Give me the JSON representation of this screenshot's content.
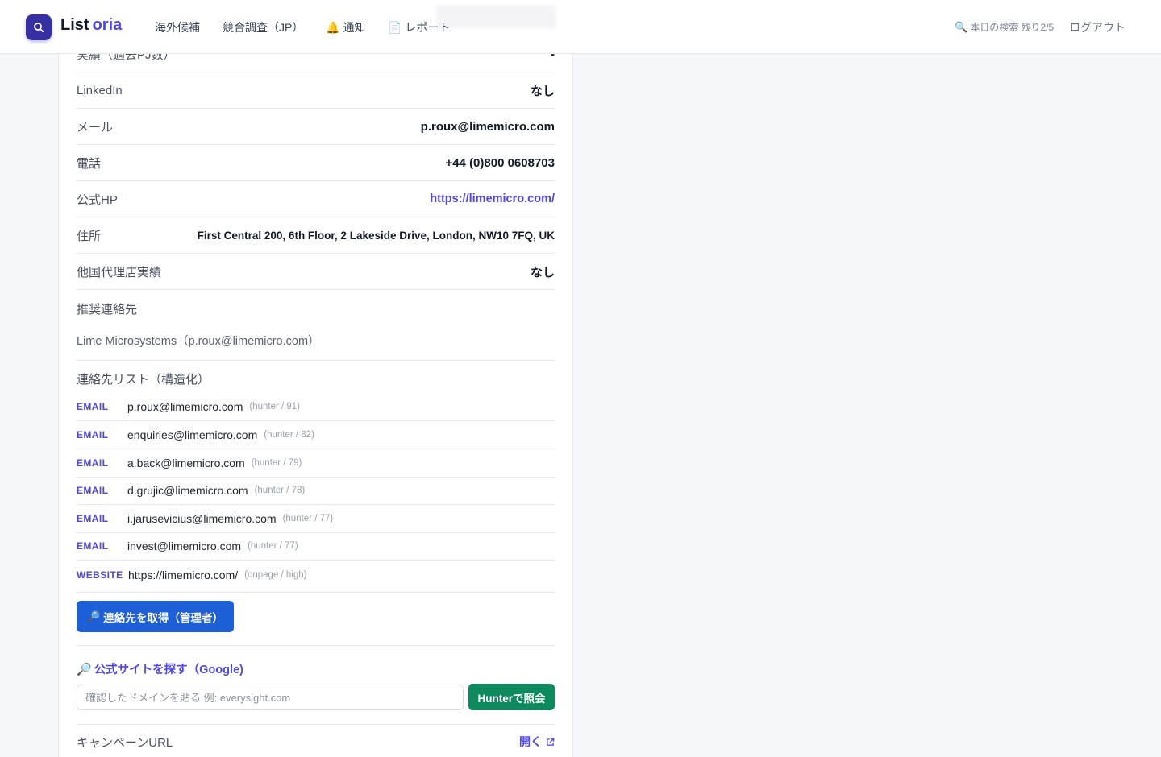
{
  "header": {
    "brand_part1": "List",
    "brand_part2": "oria",
    "nav": [
      {
        "label": "海外候補",
        "icon": ""
      },
      {
        "label": "競合調査（JP）",
        "icon": ""
      },
      {
        "label": "通知",
        "icon": "🔔"
      },
      {
        "label": "レポート",
        "icon": "📄"
      }
    ],
    "quota_icon": "🔍",
    "quota_text": "本日の検索 残り2/5",
    "logout_label": "ログアウト"
  },
  "details": {
    "partial_label": "実績（過去PJ数）",
    "partial_value": "-",
    "rows": [
      {
        "label": "LinkedIn",
        "value": "なし"
      },
      {
        "label": "メール",
        "value": "p.roux@limemicro.com"
      },
      {
        "label": "電話",
        "value": "+44 (0)800 0608703"
      },
      {
        "label": "公式HP",
        "value": "https://limemicro.com/"
      },
      {
        "label": "住所",
        "value": "First Central 200, 6th Floor, 2 Lakeside Drive, London, NW10 7FQ, UK"
      },
      {
        "label": "他国代理店実績",
        "value": "なし"
      }
    ]
  },
  "recommended": {
    "label": "推奨連絡先",
    "text": "Lime Microsystems（p.roux@limemicro.com）"
  },
  "contacts": {
    "label": "連絡先リスト（構造化）",
    "items": [
      {
        "type": "EMAIL",
        "value": "p.roux@limemicro.com",
        "meta": "(hunter / 91)"
      },
      {
        "type": "EMAIL",
        "value": "enquiries@limemicro.com",
        "meta": "(hunter / 82)"
      },
      {
        "type": "EMAIL",
        "value": "a.back@limemicro.com",
        "meta": "(hunter / 79)"
      },
      {
        "type": "EMAIL",
        "value": "d.grujic@limemicro.com",
        "meta": "(hunter / 78)"
      },
      {
        "type": "EMAIL",
        "value": "i.jarusevicius@limemicro.com",
        "meta": "(hunter / 77)"
      },
      {
        "type": "EMAIL",
        "value": "invest@limemicro.com",
        "meta": "(hunter / 77)"
      },
      {
        "type": "WEBSITE",
        "value": "https://limemicro.com/",
        "meta": "(onpage / high)"
      }
    ],
    "fetch_icon": "🔎",
    "fetch_label": "連絡先を取得（管理者）"
  },
  "google": {
    "icon": "🔎",
    "label": "公式サイトを探す（Google)",
    "input_placeholder": "確認したドメインを貼る 例: everysight.com",
    "input_value": "",
    "hunter_label": "Hunterで照会"
  },
  "campaign": {
    "label": "キャンペーンURL",
    "open_label": "開く"
  }
}
